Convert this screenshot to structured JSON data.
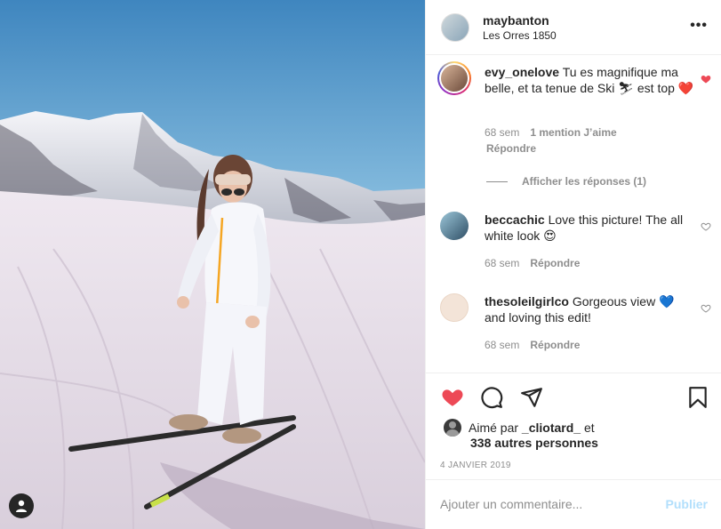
{
  "post": {
    "username": "maybanton",
    "location": "Les Orres 1850",
    "more_icon": "more-horizontal-icon",
    "more_label": "•••"
  },
  "comments": [
    {
      "username": "evy_onelove",
      "text": "Tu es magnifique ma belle, et ta tenue de Ski",
      "emoji_1": "⛷",
      "text_2": "est top",
      "emoji_2": "❤️",
      "time": "68 sem",
      "likes": "1 mention J’aime",
      "reply_label": "Répondre",
      "liked": true,
      "view_replies": "Afficher les réponses (1)"
    },
    {
      "username": "beccachic",
      "text": "Love this picture! The all white look",
      "emoji_1": "😍",
      "time": "68 sem",
      "reply_label": "Répondre",
      "liked": false
    },
    {
      "username": "thesoleilgirlco",
      "text": "Gorgeous view",
      "emoji_1": "💙",
      "text_2": "and loving this edit!",
      "time": "68 sem",
      "reply_label": "Répondre",
      "liked": false
    }
  ],
  "actions": {
    "liked_by_prefix": "Aimé par",
    "liked_by_user": "_cliotard_",
    "liked_by_and": "et",
    "others": "338 autres personnes",
    "date": "4 JANVIER 2019"
  },
  "add_comment": {
    "placeholder": "Ajouter un commentaire...",
    "publish_label": "Publier"
  },
  "colors": {
    "like_red": "#ed4956",
    "publish_disabled": "#b2dffc",
    "meta_gray": "#8e8e8e"
  }
}
